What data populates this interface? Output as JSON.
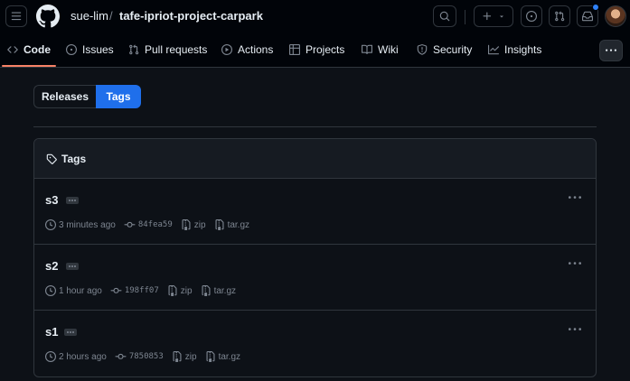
{
  "header": {
    "owner": "sue-lim",
    "slash": "/",
    "repo": "tafe-ipriot-project-carpark"
  },
  "tabs": [
    {
      "label": "Code",
      "icon": "code-icon"
    },
    {
      "label": "Issues",
      "icon": "issue-icon"
    },
    {
      "label": "Pull requests",
      "icon": "pull-request-icon"
    },
    {
      "label": "Actions",
      "icon": "play-icon"
    },
    {
      "label": "Projects",
      "icon": "table-icon"
    },
    {
      "label": "Wiki",
      "icon": "book-icon"
    },
    {
      "label": "Security",
      "icon": "shield-icon"
    },
    {
      "label": "Insights",
      "icon": "graph-icon"
    }
  ],
  "toggle": {
    "releases": "Releases",
    "tags": "Tags"
  },
  "box": {
    "title": "Tags"
  },
  "tags": [
    {
      "name": "s3",
      "time": "3 minutes ago",
      "sha": "84fea59",
      "zip": "zip",
      "targz": "tar.gz"
    },
    {
      "name": "s2",
      "time": "1 hour ago",
      "sha": "198ff07",
      "zip": "zip",
      "targz": "tar.gz"
    },
    {
      "name": "s1",
      "time": "2 hours ago",
      "sha": "7850853",
      "zip": "zip",
      "targz": "tar.gz"
    }
  ],
  "colors": {
    "accent": "#1f6feb",
    "tab_underline": "#f78166",
    "notification": "#2f81f7"
  }
}
